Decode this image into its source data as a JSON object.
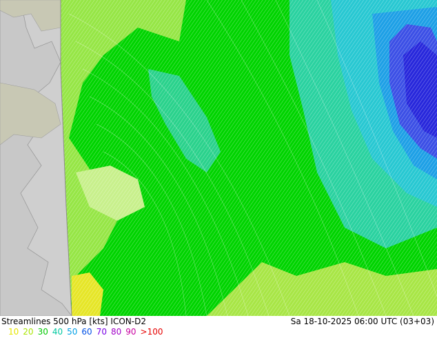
{
  "title": "Streamlines 500 hPa [kts] ICON-D2",
  "timestamp": "Sa 18-10-2025 06:00 UTC (03+03)",
  "legend": [
    {
      "label": "10",
      "color": "#e6e600"
    },
    {
      "label": "20",
      "color": "#a8e600"
    },
    {
      "label": "30",
      "color": "#00c800"
    },
    {
      "label": "40",
      "color": "#00c8a0"
    },
    {
      "label": "50",
      "color": "#00a0e6"
    },
    {
      "label": "60",
      "color": "#0050e6"
    },
    {
      "label": "70",
      "color": "#7800e6"
    },
    {
      "label": "80",
      "color": "#a000c8"
    },
    {
      "label": "90",
      "color": "#c800a0"
    },
    {
      "label": ">100",
      "color": "#e60000"
    }
  ],
  "colors": {
    "land_grey": "#cfcfcf",
    "sea_outside": "#e6e6e6",
    "wind_green": "#00d400",
    "wind_light_green": "#96e646",
    "wind_teal": "#2ad28c",
    "wind_cyan": "#28c8d2",
    "wind_blue": "#3c64e6",
    "wind_yellow": "#e6e628"
  }
}
